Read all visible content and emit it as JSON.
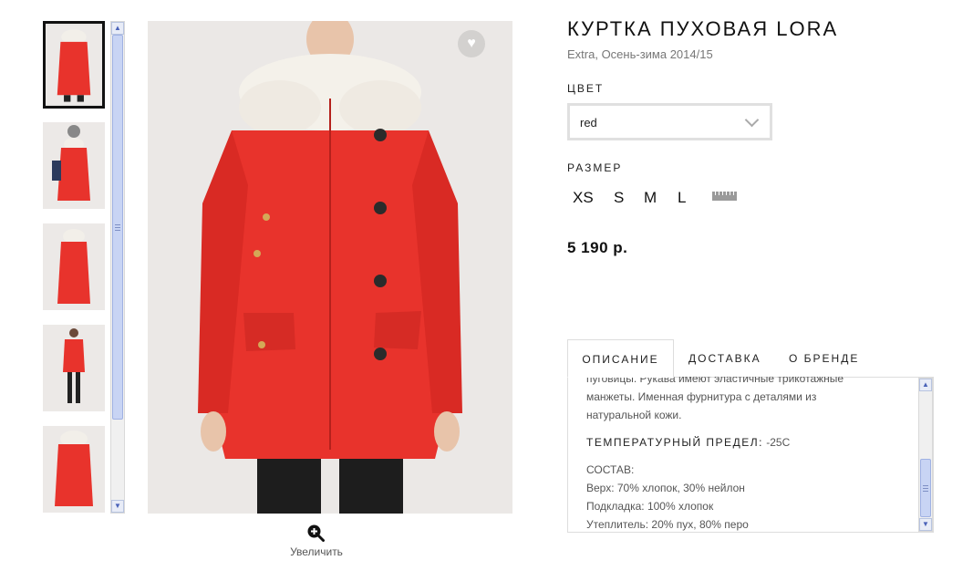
{
  "product": {
    "title": "КУРТКА ПУХОВАЯ LORA",
    "subtitle": "Extra, Осень-зима 2014/15",
    "color_label": "ЦВЕТ",
    "color_value": "red",
    "size_label": "РАЗМЕР",
    "sizes": [
      "XS",
      "S",
      "M",
      "L"
    ],
    "price": "5 190 р."
  },
  "gallery": {
    "zoom_label": "Увеличить",
    "thumbnail_count": 5,
    "selected_index": 0
  },
  "tabs": [
    "ОПИСАНИЕ",
    "ДОСТАВКА",
    "О БРЕНДЕ"
  ],
  "description": {
    "lines": [
      "пуговицы. Рукава имеют эластичные трикотажные",
      "манжеты. Именная фурнитура с деталями из",
      "натуральной кожи."
    ],
    "temp_label": "ТЕМПЕРАТУРНЫЙ ПРЕДЕЛ:",
    "temp_value": " -25С",
    "composition_title": "СОСТАВ:",
    "composition": [
      "Верх: 70% хлопок, 30% нейлон",
      "Подкладка: 100% хлопок",
      "Утеплитель: 20% пух, 80% перо"
    ]
  },
  "colors": {
    "jacket": "#e8332c",
    "accent": "#111111"
  }
}
